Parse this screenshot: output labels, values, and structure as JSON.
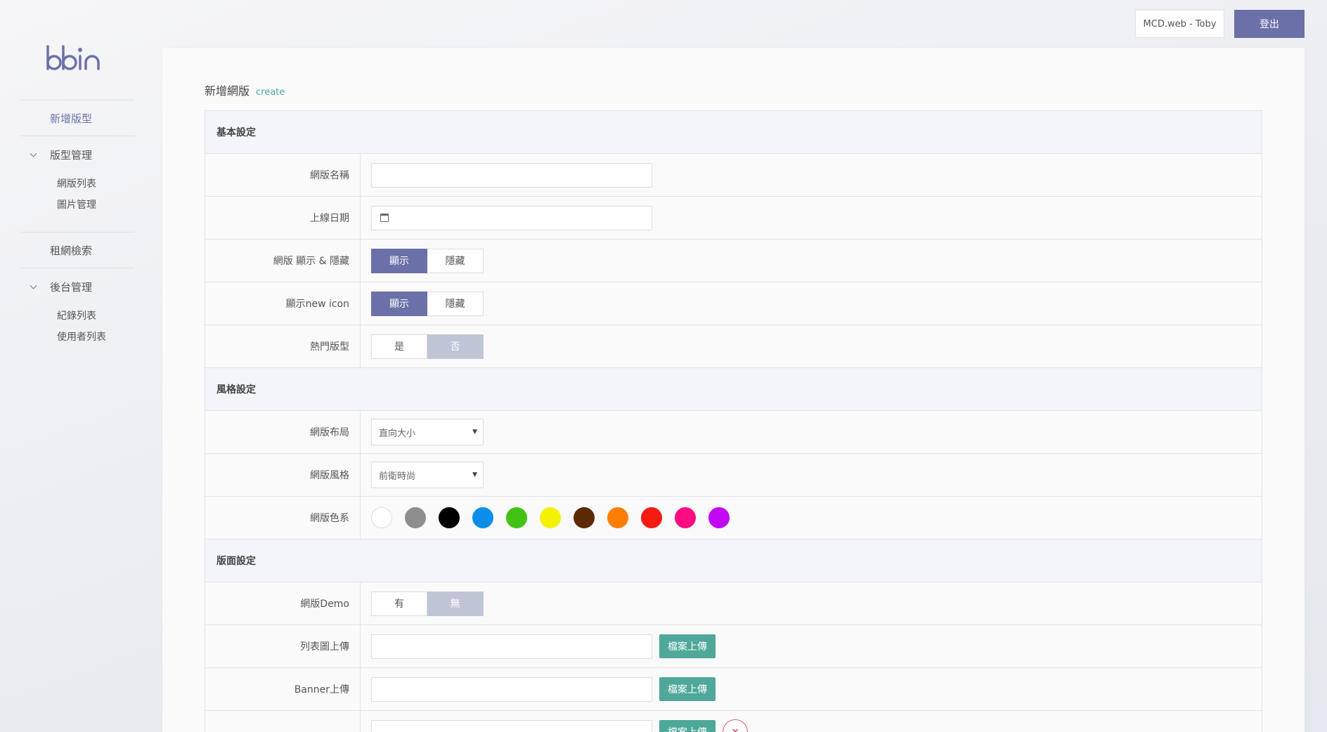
{
  "brand": {
    "logo_text": "bbin",
    "accent": "#6b70a8",
    "teal": "#4fa89a"
  },
  "sidebar": {
    "items": [
      {
        "label": "新增版型"
      },
      {
        "label": "版型管理",
        "children": [
          {
            "label": "網版列表"
          },
          {
            "label": "圖片管理"
          }
        ]
      },
      {
        "label": "租網檢索"
      },
      {
        "label": "後台管理",
        "children": [
          {
            "label": "紀錄列表"
          },
          {
            "label": "使用者列表"
          }
        ]
      }
    ]
  },
  "header": {
    "user": "MCD.web - Toby",
    "logout": "登出"
  },
  "page": {
    "title": "新增網版",
    "subtitle": "create"
  },
  "sections": {
    "basic": "基本設定",
    "style": "風格設定",
    "layout": "版面設定"
  },
  "fields": {
    "name": {
      "label": "網版名稱",
      "value": ""
    },
    "launch_date": {
      "label": "上線日期",
      "value": ""
    },
    "visibility": {
      "label": "網版 顯示 & 隱藏",
      "on": "顯示",
      "off": "隱藏"
    },
    "new_icon": {
      "label": "顯示new icon",
      "on": "顯示",
      "off": "隱藏"
    },
    "hot": {
      "label": "熱門版型",
      "yes": "是",
      "no": "否"
    },
    "layout_select": {
      "label": "網版布局",
      "value": "直向大小"
    },
    "style_select": {
      "label": "網版風格",
      "value": "前衛時尚"
    },
    "colors": {
      "label": "網版色系",
      "swatches": [
        "#ffffff",
        "#8e8e8e",
        "#000000",
        "#0c8ee8",
        "#42c214",
        "#f5f200",
        "#5c2a05",
        "#ff7e04",
        "#f61a10",
        "#fd0b82",
        "#c108f5"
      ]
    },
    "demo": {
      "label": "網版Demo",
      "yes": "有",
      "no": "無"
    },
    "list_upload": {
      "label": "列表圖上傳",
      "button": "檔案上傳",
      "value": ""
    },
    "banner_upload": {
      "label": "Banner上傳",
      "button": "檔案上傳",
      "value": ""
    },
    "extra_upload": {
      "button": "檔案上傳",
      "value": "",
      "remove": "×"
    }
  }
}
